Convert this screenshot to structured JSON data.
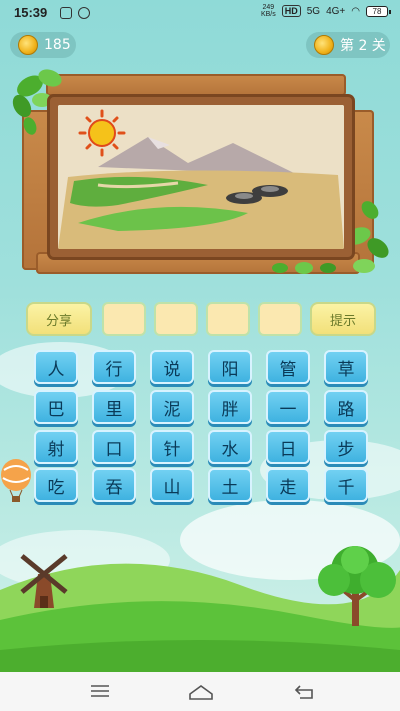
{
  "status_bar": {
    "time": "15:39",
    "net_speed_value": "249",
    "net_speed_unit": "KB/s",
    "hd": "HD",
    "signal_a": "5G",
    "signal_b": "4G+",
    "battery": "78"
  },
  "header": {
    "coins": "185",
    "level": "第 2 关"
  },
  "answer_row": {
    "share_label": "分享",
    "hint_label": "提示",
    "slots": [
      "",
      "",
      "",
      ""
    ]
  },
  "tiles": [
    [
      "人",
      "行",
      "说",
      "阳",
      "管",
      "草"
    ],
    [
      "巴",
      "里",
      "泥",
      "胖",
      "一",
      "路"
    ],
    [
      "射",
      "口",
      "针",
      "水",
      "日",
      "步"
    ],
    [
      "吃",
      "吞",
      "山",
      "土",
      "走",
      "千"
    ]
  ],
  "colors": {
    "tile_blue": "#3fb2e0",
    "button_yellow": "#f2e07a",
    "sky": "#9fe0dc",
    "grass": "#5cc23a"
  }
}
